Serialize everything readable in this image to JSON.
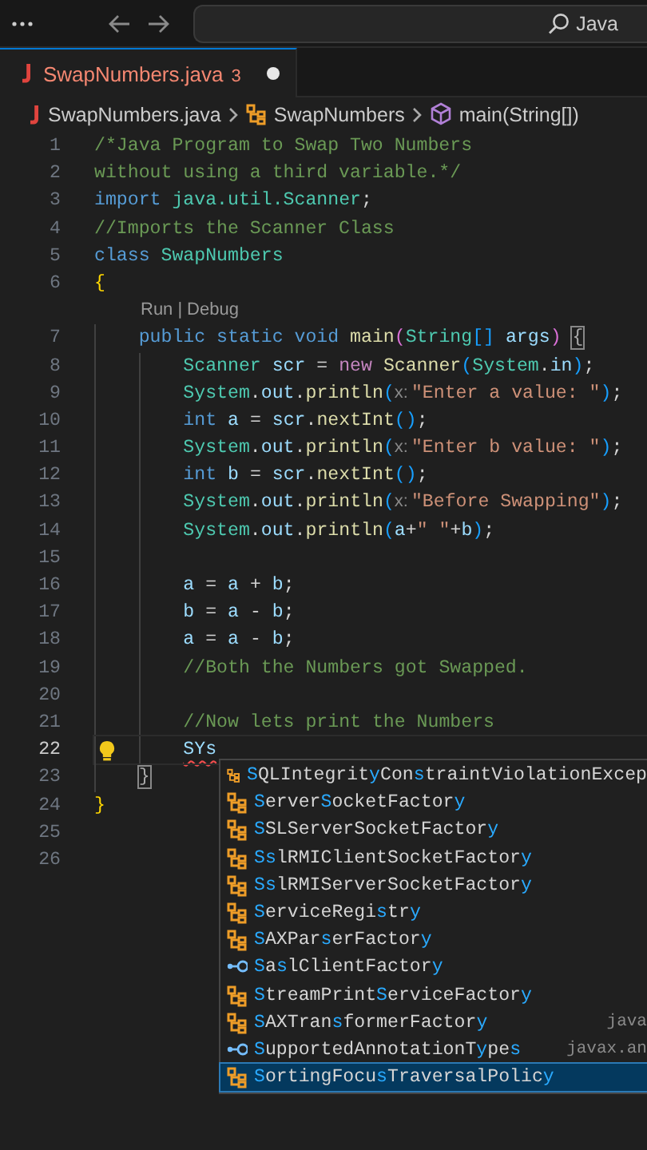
{
  "title_bar": {
    "search": "Java"
  },
  "tabs": [
    {
      "label": "SwapNumbers.java",
      "problems": "3",
      "modified": true,
      "selected": true
    }
  ],
  "breadcrumb": [
    {
      "kind": "file",
      "label": "SwapNumbers.java"
    },
    {
      "kind": "class",
      "label": "SwapNumbers"
    },
    {
      "kind": "method",
      "label": "main(String[])"
    }
  ],
  "editor": {
    "lines": [
      {
        "number": "1",
        "current": false,
        "tokens": [
          {
            "text": "/*Java Program to Swap Two Numbers",
            "kind": "comment"
          }
        ]
      },
      {
        "number": "2",
        "current": false,
        "tokens": [
          {
            "text": "without using a third variable.*/",
            "kind": "comment"
          }
        ]
      },
      {
        "number": "3",
        "current": false,
        "tokens": [
          {
            "text": "import ",
            "kind": "keyword"
          },
          {
            "text": "java.util.Scanner",
            "kind": "type"
          },
          {
            "text": ";",
            "kind": "plain"
          }
        ]
      },
      {
        "number": "4",
        "current": false,
        "tokens": [
          {
            "text": "//Imports the Scanner Class",
            "kind": "comment"
          }
        ]
      },
      {
        "number": "5",
        "current": false,
        "tokens": [
          {
            "text": "class ",
            "kind": "keyword"
          },
          {
            "text": "SwapNumbers",
            "kind": "type"
          }
        ]
      },
      {
        "number": "6",
        "current": false,
        "tokens": [
          {
            "text": "{",
            "kind": "bracket1"
          }
        ],
        "children": [
          {
            "number": "7",
            "current": false,
            "code_lens": {
              "items": [
                "Run",
                "Debug"
              ],
              "separator": "|"
            },
            "tokens": [
              {
                "text": "public static void ",
                "kind": "keyword"
              },
              {
                "text": "main",
                "kind": "function"
              },
              {
                "text": "(",
                "kind": "bracket2"
              },
              {
                "text": "String",
                "kind": "type"
              },
              {
                "text": "[]",
                "kind": "bracket3"
              },
              {
                "text": " args",
                "kind": "variable"
              },
              {
                "text": ") ",
                "kind": "bracket2"
              },
              {
                "text": "{",
                "kind": "matched"
              }
            ],
            "children": [
              {
                "number": "8",
                "current": false,
                "tokens": [
                  {
                    "text": "Scanner ",
                    "kind": "type"
                  },
                  {
                    "text": "scr",
                    "kind": "variable"
                  },
                  {
                    "text": " = ",
                    "kind": "plain"
                  },
                  {
                    "text": "new ",
                    "kind": "control"
                  },
                  {
                    "text": "Scanner",
                    "kind": "function"
                  },
                  {
                    "text": "(",
                    "kind": "bracket3"
                  },
                  {
                    "text": "System",
                    "kind": "type"
                  },
                  {
                    "text": ".",
                    "kind": "plain"
                  },
                  {
                    "text": "in",
                    "kind": "variable"
                  },
                  {
                    "text": ")",
                    "kind": "bracket3"
                  },
                  {
                    "text": ";",
                    "kind": "plain"
                  }
                ]
              },
              {
                "number": "9",
                "current": false,
                "tokens": [
                  {
                    "text": "System",
                    "kind": "type"
                  },
                  {
                    "text": ".",
                    "kind": "plain"
                  },
                  {
                    "text": "out",
                    "kind": "variable"
                  },
                  {
                    "text": ".",
                    "kind": "plain"
                  },
                  {
                    "text": "println",
                    "kind": "function"
                  },
                  {
                    "text": "(",
                    "kind": "bracket3"
                  },
                  {
                    "text": "x:",
                    "kind": "hint"
                  },
                  {
                    "text": "\"Enter a value: \"",
                    "kind": "string"
                  },
                  {
                    "text": ")",
                    "kind": "bracket3"
                  },
                  {
                    "text": ";",
                    "kind": "plain"
                  }
                ]
              },
              {
                "number": "10",
                "current": false,
                "tokens": [
                  {
                    "text": "int ",
                    "kind": "keyword"
                  },
                  {
                    "text": "a",
                    "kind": "variable"
                  },
                  {
                    "text": " = ",
                    "kind": "plain"
                  },
                  {
                    "text": "scr",
                    "kind": "variable"
                  },
                  {
                    "text": ".",
                    "kind": "plain"
                  },
                  {
                    "text": "nextInt",
                    "kind": "function"
                  },
                  {
                    "text": "()",
                    "kind": "bracket3"
                  },
                  {
                    "text": ";",
                    "kind": "plain"
                  }
                ]
              },
              {
                "number": "11",
                "current": false,
                "tokens": [
                  {
                    "text": "System",
                    "kind": "type"
                  },
                  {
                    "text": ".",
                    "kind": "plain"
                  },
                  {
                    "text": "out",
                    "kind": "variable"
                  },
                  {
                    "text": ".",
                    "kind": "plain"
                  },
                  {
                    "text": "println",
                    "kind": "function"
                  },
                  {
                    "text": "(",
                    "kind": "bracket3"
                  },
                  {
                    "text": "x:",
                    "kind": "hint"
                  },
                  {
                    "text": "\"Enter b value: \"",
                    "kind": "string"
                  },
                  {
                    "text": ")",
                    "kind": "bracket3"
                  },
                  {
                    "text": ";",
                    "kind": "plain"
                  }
                ]
              },
              {
                "number": "12",
                "current": false,
                "tokens": [
                  {
                    "text": "int ",
                    "kind": "keyword"
                  },
                  {
                    "text": "b",
                    "kind": "variable"
                  },
                  {
                    "text": " = ",
                    "kind": "plain"
                  },
                  {
                    "text": "scr",
                    "kind": "variable"
                  },
                  {
                    "text": ".",
                    "kind": "plain"
                  },
                  {
                    "text": "nextInt",
                    "kind": "function"
                  },
                  {
                    "text": "()",
                    "kind": "bracket3"
                  },
                  {
                    "text": ";",
                    "kind": "plain"
                  }
                ]
              },
              {
                "number": "13",
                "current": false,
                "tokens": [
                  {
                    "text": "System",
                    "kind": "type"
                  },
                  {
                    "text": ".",
                    "kind": "plain"
                  },
                  {
                    "text": "out",
                    "kind": "variable"
                  },
                  {
                    "text": ".",
                    "kind": "plain"
                  },
                  {
                    "text": "println",
                    "kind": "function"
                  },
                  {
                    "text": "(",
                    "kind": "bracket3"
                  },
                  {
                    "text": "x:",
                    "kind": "hint"
                  },
                  {
                    "text": "\"Before Swapping\"",
                    "kind": "string"
                  },
                  {
                    "text": ")",
                    "kind": "bracket3"
                  },
                  {
                    "text": ";",
                    "kind": "plain"
                  }
                ]
              },
              {
                "number": "14",
                "current": false,
                "tokens": [
                  {
                    "text": "System",
                    "kind": "type"
                  },
                  {
                    "text": ".",
                    "kind": "plain"
                  },
                  {
                    "text": "out",
                    "kind": "variable"
                  },
                  {
                    "text": ".",
                    "kind": "plain"
                  },
                  {
                    "text": "println",
                    "kind": "function"
                  },
                  {
                    "text": "(",
                    "kind": "bracket3"
                  },
                  {
                    "text": "a",
                    "kind": "variable"
                  },
                  {
                    "text": "+",
                    "kind": "plain"
                  },
                  {
                    "text": "\" \"",
                    "kind": "string"
                  },
                  {
                    "text": "+",
                    "kind": "plain"
                  },
                  {
                    "text": "b",
                    "kind": "variable"
                  },
                  {
                    "text": ")",
                    "kind": "bracket3"
                  },
                  {
                    "text": ";",
                    "kind": "plain"
                  }
                ]
              },
              {
                "number": "15",
                "current": false
              },
              {
                "number": "16",
                "current": false,
                "tokens": [
                  {
                    "text": "a",
                    "kind": "variable"
                  },
                  {
                    "text": " = ",
                    "kind": "plain"
                  },
                  {
                    "text": "a",
                    "kind": "variable"
                  },
                  {
                    "text": " + ",
                    "kind": "plain"
                  },
                  {
                    "text": "b",
                    "kind": "variable"
                  },
                  {
                    "text": ";",
                    "kind": "plain"
                  }
                ]
              },
              {
                "number": "17",
                "current": false,
                "tokens": [
                  {
                    "text": "b",
                    "kind": "variable"
                  },
                  {
                    "text": " = ",
                    "kind": "plain"
                  },
                  {
                    "text": "a",
                    "kind": "variable"
                  },
                  {
                    "text": " - ",
                    "kind": "plain"
                  },
                  {
                    "text": "b",
                    "kind": "variable"
                  },
                  {
                    "text": ";",
                    "kind": "plain"
                  }
                ]
              },
              {
                "number": "18",
                "current": false,
                "tokens": [
                  {
                    "text": "a",
                    "kind": "variable"
                  },
                  {
                    "text": " = ",
                    "kind": "plain"
                  },
                  {
                    "text": "a",
                    "kind": "variable"
                  },
                  {
                    "text": " - ",
                    "kind": "plain"
                  },
                  {
                    "text": "b",
                    "kind": "variable"
                  },
                  {
                    "text": ";",
                    "kind": "plain"
                  }
                ]
              },
              {
                "number": "19",
                "current": false,
                "tokens": [
                  {
                    "text": "//Both the Numbers got Swapped.",
                    "kind": "comment"
                  }
                ]
              },
              {
                "number": "20",
                "current": false
              },
              {
                "number": "21",
                "current": false,
                "tokens": [
                  {
                    "text": "//Now lets print the Numbers",
                    "kind": "comment"
                  }
                ]
              },
              {
                "number": "22",
                "current": true,
                "tokens": [
                  {
                    "text": "SYs",
                    "kind": "error"
                  }
                ]
              }
            ]
          },
          {
            "number": "23",
            "current": false,
            "tokens": [
              {
                "text": "}",
                "kind": "matched"
              }
            ]
          }
        ]
      },
      {
        "number": "24",
        "current": false,
        "tokens": [
          {
            "text": "}",
            "kind": "bracket1"
          }
        ]
      },
      {
        "number": "25",
        "current": false
      },
      {
        "number": "26",
        "current": false
      }
    ]
  },
  "suggestions": [
    {
      "kind": "class",
      "selected": false,
      "parts": [
        {
          "text": "S",
          "match": true
        },
        {
          "text": "QLIntegrit",
          "match": false
        },
        {
          "text": "y",
          "match": true
        },
        {
          "text": "Con",
          "match": false
        },
        {
          "text": "s",
          "match": true
        },
        {
          "text": "traintViolationExcep",
          "match": false
        }
      ]
    },
    {
      "kind": "class",
      "selected": false,
      "parts": [
        {
          "text": "S",
          "match": true
        },
        {
          "text": "erver",
          "match": false
        },
        {
          "text": "S",
          "match": true
        },
        {
          "text": "ocketFactor",
          "match": false
        },
        {
          "text": "y",
          "match": true
        }
      ]
    },
    {
      "kind": "class",
      "selected": false,
      "parts": [
        {
          "text": "S",
          "match": true
        },
        {
          "text": "SLServerSocketFactor",
          "match": false
        },
        {
          "text": "y",
          "match": true
        }
      ]
    },
    {
      "kind": "class",
      "selected": false,
      "parts": [
        {
          "text": "S",
          "match": true
        },
        {
          "text": "s",
          "match": true
        },
        {
          "text": "lRMIClientSocketFactor",
          "match": false
        },
        {
          "text": "y",
          "match": true
        }
      ]
    },
    {
      "kind": "class",
      "selected": false,
      "parts": [
        {
          "text": "S",
          "match": true
        },
        {
          "text": "s",
          "match": true
        },
        {
          "text": "lRMIServerSocketFactor",
          "match": false
        },
        {
          "text": "y",
          "match": true
        }
      ]
    },
    {
      "kind": "class",
      "selected": false,
      "parts": [
        {
          "text": "S",
          "match": true
        },
        {
          "text": "erviceRegi",
          "match": false
        },
        {
          "text": "s",
          "match": true
        },
        {
          "text": "tr",
          "match": false
        },
        {
          "text": "y",
          "match": true
        }
      ]
    },
    {
      "kind": "class",
      "selected": false,
      "parts": [
        {
          "text": "S",
          "match": true
        },
        {
          "text": "AXPar",
          "match": false
        },
        {
          "text": "s",
          "match": true
        },
        {
          "text": "erFactor",
          "match": false
        },
        {
          "text": "y",
          "match": true
        }
      ]
    },
    {
      "kind": "interface",
      "selected": false,
      "parts": [
        {
          "text": "S",
          "match": true
        },
        {
          "text": "a",
          "match": false
        },
        {
          "text": "s",
          "match": true
        },
        {
          "text": "lClientFactor",
          "match": false
        },
        {
          "text": "y",
          "match": true
        }
      ]
    },
    {
      "kind": "class",
      "selected": false,
      "parts": [
        {
          "text": "S",
          "match": true
        },
        {
          "text": "treamPrint",
          "match": false
        },
        {
          "text": "S",
          "match": true
        },
        {
          "text": "erviceFactor",
          "match": false
        },
        {
          "text": "y",
          "match": true
        }
      ]
    },
    {
      "kind": "class",
      "selected": false,
      "detail": "java",
      "parts": [
        {
          "text": "S",
          "match": true
        },
        {
          "text": "AXTran",
          "match": false
        },
        {
          "text": "s",
          "match": true
        },
        {
          "text": "formerFactor",
          "match": false
        },
        {
          "text": "y",
          "match": true
        }
      ]
    },
    {
      "kind": "interface",
      "selected": false,
      "detail": "javax.an",
      "parts": [
        {
          "text": "S",
          "match": true
        },
        {
          "text": "upportedAnnotationT",
          "match": false
        },
        {
          "text": "y",
          "match": true
        },
        {
          "text": "pe",
          "match": false
        },
        {
          "text": "s",
          "match": true
        }
      ]
    },
    {
      "kind": "class",
      "selected": true,
      "parts": [
        {
          "text": "S",
          "match": true
        },
        {
          "text": "ortingFocu",
          "match": false
        },
        {
          "text": "s",
          "match": true
        },
        {
          "text": "TraversalPolic",
          "match": false
        },
        {
          "text": "y",
          "match": true
        }
      ]
    }
  ]
}
